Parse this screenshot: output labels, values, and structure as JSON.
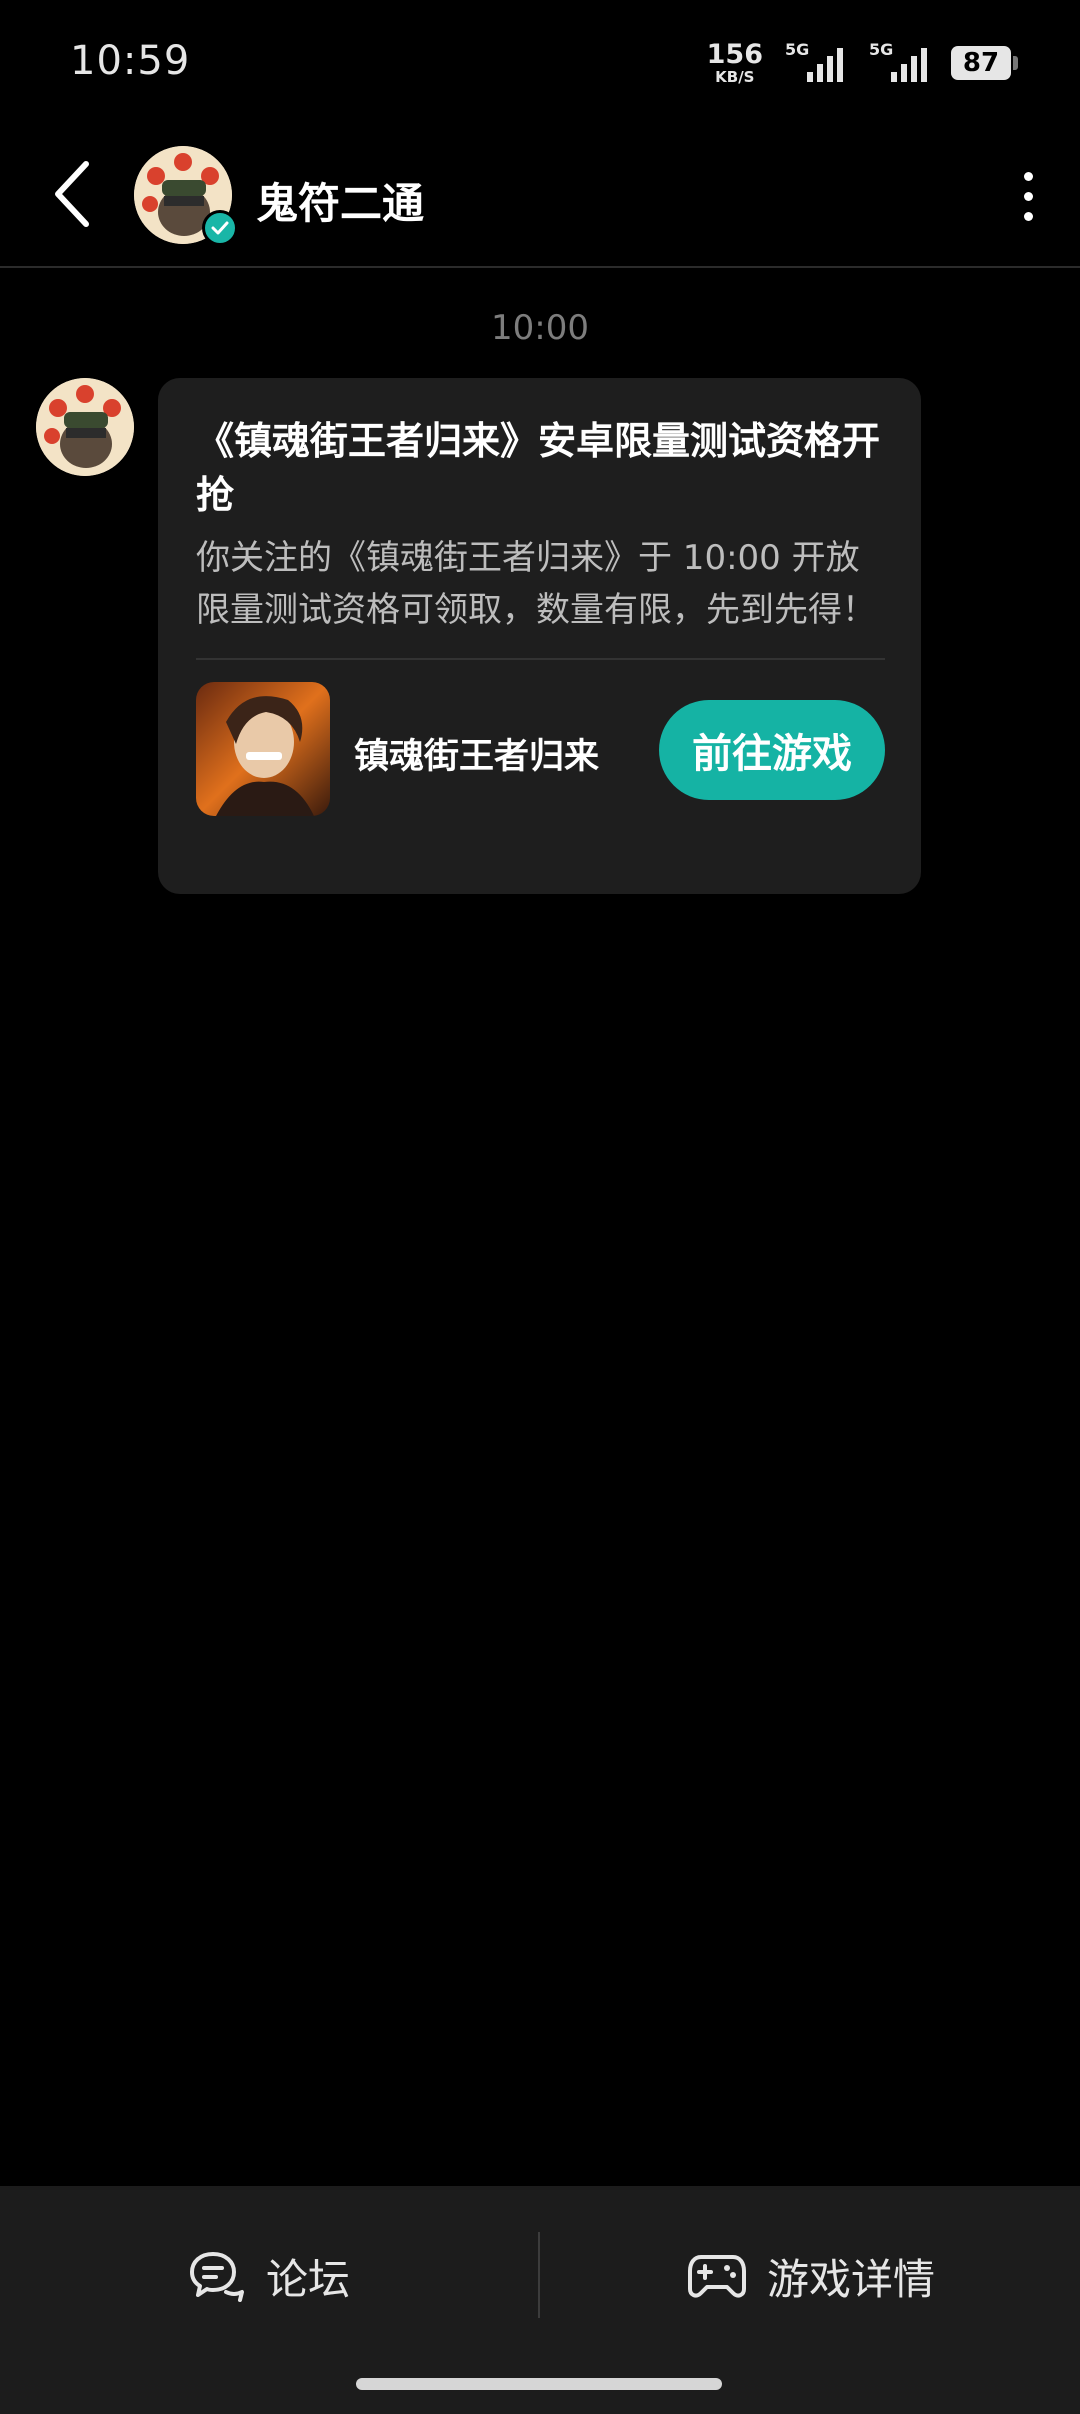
{
  "status_bar": {
    "time": "10:59",
    "net_speed_value": "156",
    "net_speed_unit": "KB/S",
    "signal_1_label": "5G",
    "signal_2_label": "5G",
    "battery": "87"
  },
  "header": {
    "title": "鬼符二通"
  },
  "chat": {
    "timestamp": "10:00",
    "card": {
      "title": "《镇魂街王者归来》安卓限量测试资格开抢",
      "body": "你关注的《镇魂街王者归来》于 10:00 开放限量测试资格可领取，数量有限，先到先得！",
      "game_name": "镇魂街王者归来",
      "action_label": "前往游戏"
    }
  },
  "bottom_bar": {
    "forum_label": "论坛",
    "game_details_label": "游戏详情"
  },
  "colors": {
    "accent": "#15b3a4",
    "background": "#000000",
    "card": "#1e1e1e",
    "bottom_bar": "#1c1c1c"
  },
  "icons": [
    "back-arrow-icon",
    "verified-check-icon",
    "more-vertical-icon",
    "forum-chat-icon",
    "gamepad-icon"
  ]
}
